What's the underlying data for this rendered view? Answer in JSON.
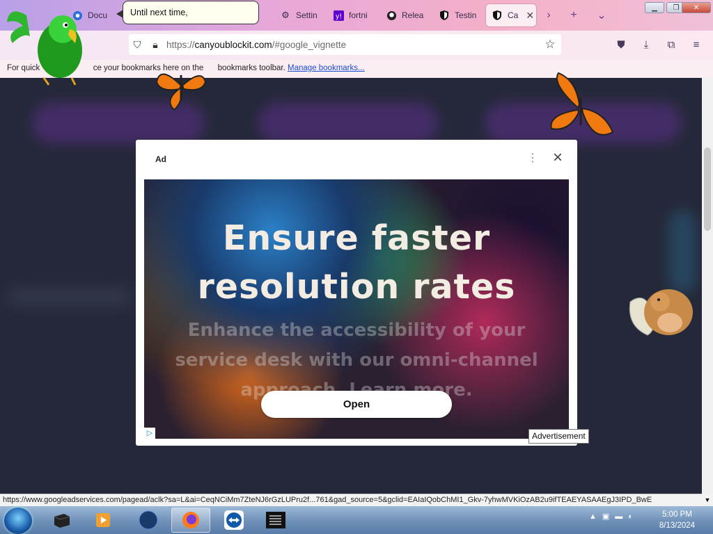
{
  "browser": {
    "tabs": [
      {
        "title": "Docu",
        "icon": "docs-icon"
      },
      {
        "title": "Settin",
        "icon": "gear-icon"
      },
      {
        "title": "fortni",
        "icon": "yahoo-icon"
      },
      {
        "title": "Relea",
        "icon": "github-icon"
      },
      {
        "title": "Testin",
        "icon": "shield-icon"
      },
      {
        "title": "Ca",
        "icon": "shield-icon",
        "active": true
      }
    ],
    "url": {
      "protocol": "https://",
      "host": "canyoublockit.com",
      "path": "/#google_vignette"
    },
    "bookmarks_text_1": "For quick",
    "bookmarks_text_2": "ce your bookmarks here on the",
    "bookmarks_text_3": "bookmarks toolbar.",
    "bookmarks_link": "Manage bookmarks..."
  },
  "ad": {
    "label": "Ad",
    "headline_1": "Ensure faster",
    "headline_2": "resolution rates",
    "sub_1": "Enhance the accessibility of your",
    "sub_2": "service desk with our omni-channel",
    "sub_3": "approach. Learn more.",
    "cta": "Open",
    "tooltip": "Advertisement"
  },
  "overlay": {
    "bubble_text": "Until next time,"
  },
  "status_url": "https://www.googleadservices.com/pagead/aclk?sa=L&ai=CeqNCiMm7ZteNJ6rGzLUPru2f...761&gad_source=5&gclid=EAIaIQobChMI1_Gkv-7yhwMVKiOzAB2u9ifTEAEYASAAEgJ3IPD_BwE",
  "taskbar": {
    "time": "5:00 PM",
    "date": "8/13/2024"
  },
  "colors": {
    "tab_gradient_start": "#b8a0e8",
    "tab_gradient_end": "#f0c0d8",
    "page_bg": "#242838",
    "link": "#1a4bd8"
  }
}
